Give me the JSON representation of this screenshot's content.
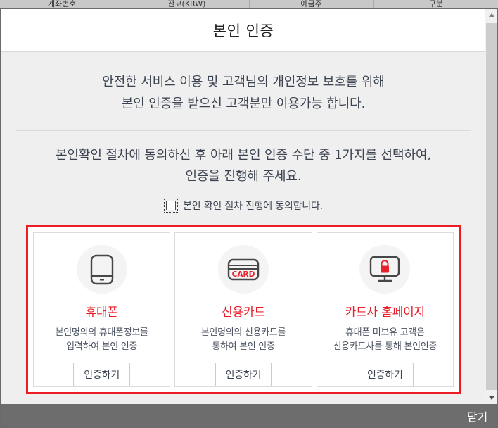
{
  "background": {
    "table_headers": [
      "계좌번호",
      "잔고(KRW)",
      "예금주",
      "구분"
    ]
  },
  "modal": {
    "title": "본인 인증",
    "intro": {
      "line1": "안전한 서비스 이용 및 고객님의 개인정보 보호를 위해",
      "line2": "본인 인증을 받으신 고객분만 이용가능 합니다."
    },
    "instruction": {
      "line1": "본인확인 절차에 동의하신 후 아래 본인 인증 수단 중 1가지를 선택하여,",
      "line2": "인증을 진행해 주세요."
    },
    "agreement": {
      "label": "본인 확인 절차 진행에 동의합니다.",
      "checked": false,
      "icon": "checkbox-unchecked-icon"
    },
    "methods": [
      {
        "id": "mobile",
        "icon": "mobile-phone-icon",
        "title": "휴대폰",
        "desc_line1": "본인명의의 휴대폰정보를",
        "desc_line2": "입력하여 본인 인증",
        "button_label": "인증하기"
      },
      {
        "id": "credit-card",
        "icon": "credit-card-icon",
        "icon_text": "CARD",
        "title": "신용카드",
        "desc_line1": "본인명의의 신용카드를",
        "desc_line2": "통하여 본인 인증",
        "button_label": "인증하기"
      },
      {
        "id": "card-company-homepage",
        "icon": "monitor-lock-icon",
        "title": "카드사 홈페이지",
        "desc_line1": "휴대폰 미보유 고객은",
        "desc_line2": "신용카드사를 통해 본인인증",
        "button_label": "인증하기"
      }
    ],
    "footer": {
      "close_label": "닫기"
    }
  },
  "colors": {
    "accent_red": "#ec1c24",
    "title_red": "#ea1b27",
    "body_text": "#3c4350",
    "panel_bg": "#efefef",
    "footer_bg": "#6d6d6d"
  }
}
